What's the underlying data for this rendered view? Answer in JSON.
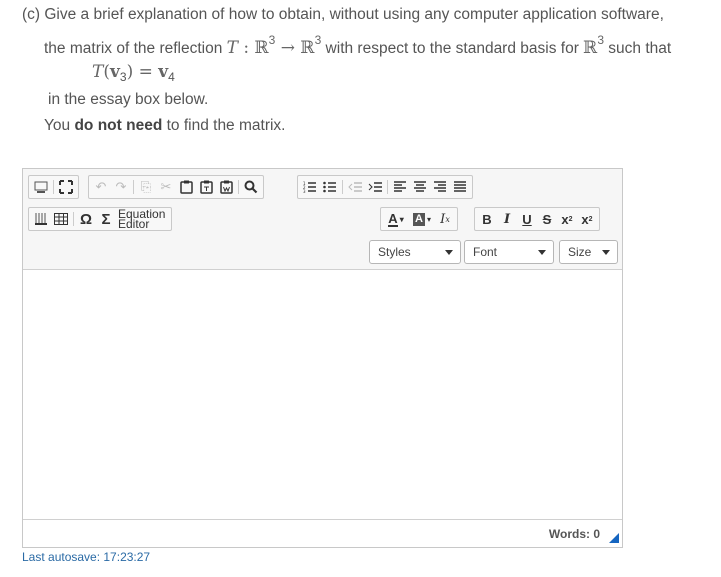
{
  "question": {
    "line1": "(c) Give a brief explanation of how to obtain, without using any computer application software,",
    "line2_a": "the matrix of the reflection ",
    "line2_T": "T",
    "line2_colon": " : ",
    "line2_R": "ℝ",
    "line2_exp": "3",
    "line2_arrow": " → ",
    "line2_R2": "ℝ",
    "line2_exp2": "3",
    "line2_b": " with respect to the standard basis for ",
    "line2_R3": "ℝ",
    "line2_exp3": "3",
    "line2_c": " such that",
    "eq_T": "T",
    "eq_open": "(",
    "eq_v": "v",
    "eq_sub3": "3",
    "eq_close": ") = ",
    "eq_v2": "v",
    "eq_sub4": "4",
    "line4": "in the essay box below.",
    "line5_a": "You ",
    "line5_bold": "do not need",
    "line5_b": " to find the matrix."
  },
  "toolbar": {
    "equation_line1": "Equation",
    "equation_line2": "Editor",
    "styles_label": "Styles",
    "font_label": "Font",
    "size_label": "Size",
    "bold": "B",
    "italic": "I",
    "underline": "U",
    "strike": "S"
  },
  "status": {
    "words": "Words: 0"
  },
  "autosave": "Last autosave: 17:23:27",
  "colors": {
    "link": "#2a6aa5",
    "resize_handle": "#1565c0"
  }
}
